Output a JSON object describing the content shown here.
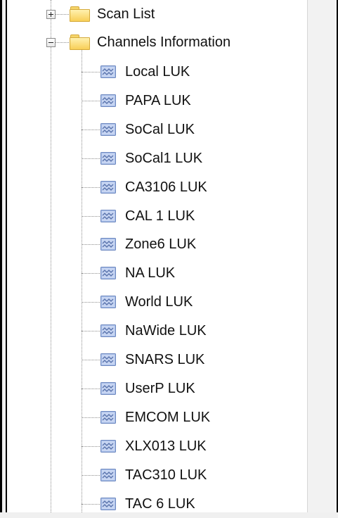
{
  "tree": {
    "root_items": [
      {
        "label": "Scan List",
        "expanded": false,
        "icon": "folder-icon"
      },
      {
        "label": "Channels Information",
        "expanded": true,
        "icon": "folder-icon"
      }
    ],
    "channels": [
      {
        "label": "Local LUK"
      },
      {
        "label": "PAPA LUK"
      },
      {
        "label": "SoCal LUK"
      },
      {
        "label": "SoCal1 LUK"
      },
      {
        "label": "CA3106 LUK"
      },
      {
        "label": "CAL 1 LUK"
      },
      {
        "label": "Zone6 LUK"
      },
      {
        "label": "NA LUK"
      },
      {
        "label": "World LUK"
      },
      {
        "label": "NaWide LUK"
      },
      {
        "label": "SNARS LUK"
      },
      {
        "label": "UserP LUK"
      },
      {
        "label": "EMCOM LUK"
      },
      {
        "label": "XLX013 LUK"
      },
      {
        "label": "TAC310 LUK"
      },
      {
        "label": "TAC 6 LUK"
      }
    ],
    "channel_icon": "channel-waveform-icon"
  },
  "colors": {
    "folder": "#f8cf57",
    "channel_icon": "#7f9fdb",
    "panel_background": "#ffffff"
  }
}
